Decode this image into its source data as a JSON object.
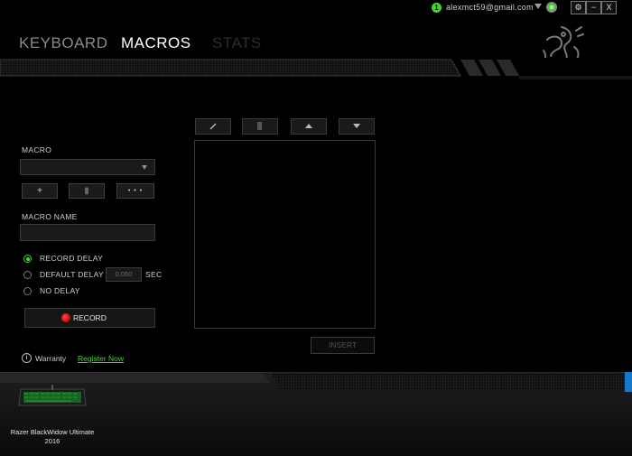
{
  "topbar": {
    "status_badge": "1",
    "email": "alexmct59@gmail.com",
    "settings_label": "⚙",
    "minimize_label": "−",
    "close_label": "X"
  },
  "nav": {
    "tabs": [
      {
        "label": "KEYBOARD",
        "active": false
      },
      {
        "label": "MACROS",
        "active": true
      },
      {
        "label": "STATS",
        "active": false
      }
    ]
  },
  "macro_panel": {
    "macro_label": "MACRO",
    "macro_select_value": "",
    "add_label": "+",
    "delete_label": "▮",
    "more_label": "• • •",
    "macro_name_label": "MACRO NAME",
    "macro_name_value": "",
    "delay_options": [
      {
        "label": "RECORD DELAY",
        "selected": true
      },
      {
        "label": "DEFAULT DELAY",
        "selected": false
      },
      {
        "label": "NO DELAY",
        "selected": false
      }
    ],
    "default_delay_value": "0.050",
    "delay_unit": "SEC",
    "record_label": "RECORD"
  },
  "editor": {
    "insert_label": "INSERT"
  },
  "footer": {
    "warranty_icon": "i",
    "warranty_label": "Warranty",
    "register_link": "Register Now",
    "device_name": "Razer BlackWidow Ultimate 2016"
  },
  "colors": {
    "accent": "#44d62c",
    "record": "#e00000",
    "background": "#000000",
    "link": "#44d62c"
  }
}
